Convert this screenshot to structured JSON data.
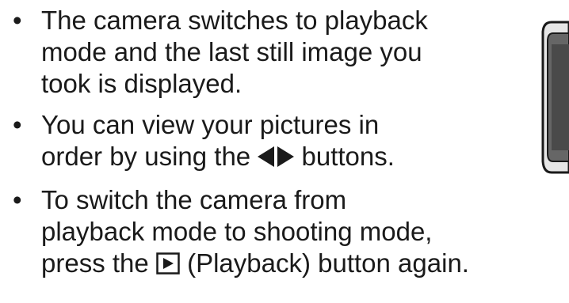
{
  "bullet_marker": "•",
  "items": [
    {
      "lines": [
        "The camera switches to playback",
        "mode and the last still image you",
        "took is displayed."
      ]
    },
    {
      "line1": "You can view your pictures in",
      "line2_before": "order by using the",
      "line2_after": "buttons.",
      "icon": "left-right-arrow-buttons-icon"
    },
    {
      "line1": "To switch the camera from",
      "line2": "playback mode to shooting mode,",
      "line3_before": "press the",
      "line3_after": "(Playback) button again.",
      "icon": "playback-button-icon"
    }
  ]
}
